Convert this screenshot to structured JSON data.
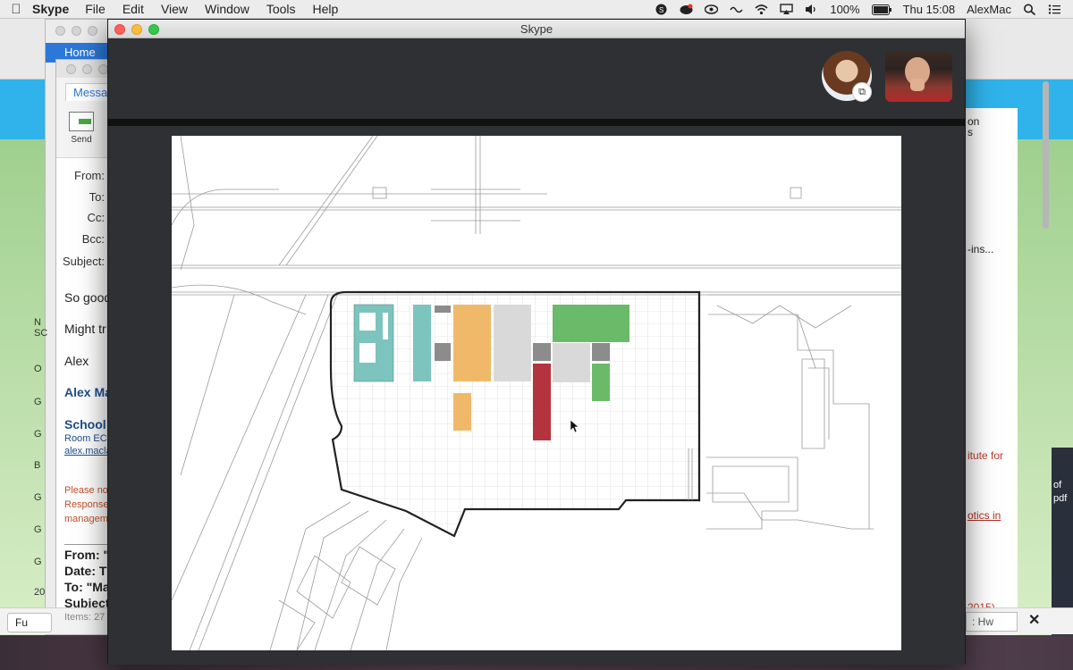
{
  "menubar": {
    "apple": "",
    "app_name": "Skype",
    "items": [
      "File",
      "Edit",
      "View",
      "Window",
      "Tools",
      "Help"
    ],
    "battery": "100%",
    "clock": "Thu 15:08",
    "user": "AlexMac",
    "icons": [
      "skype-icon",
      "creative-cloud-icon",
      "eye-icon",
      "wave-icon",
      "wifi-icon",
      "airplay-icon",
      "volume-icon",
      "battery-icon",
      "search-icon",
      "list-icon"
    ]
  },
  "mail": {
    "home_tab": "Home",
    "message_tab": "Messa",
    "send_label": "Send",
    "fields": {
      "from": "From:",
      "to": "To:",
      "cc": "Cc:",
      "bcc": "Bcc:",
      "subject": "Subject:"
    },
    "body": {
      "line1": "So good",
      "line2": "Might tr",
      "line3": "Alex",
      "sig_name": "Alex Ma",
      "sig_school": "School",
      "sig_room": "Room EC",
      "sig_email": "alex.macla",
      "notice1": "Please no",
      "notice2": "Response",
      "notice3": "managem",
      "quoted_from": "From: \"",
      "quoted_date": "Date: Th",
      "quoted_to": "To: \"Ma",
      "quoted_subject": "Subject"
    },
    "list_letters": [
      "N",
      "SC",
      "O",
      "G",
      "G",
      "B",
      "G",
      "G",
      "G",
      "20"
    ],
    "items_count": "Items: 27"
  },
  "browser": {
    "right_texts": [
      "on",
      "s",
      "-ins...",
      "itute for",
      "otics in",
      "2015)"
    ],
    "dark_corner_texts": [
      "of",
      "pdf"
    ],
    "bottom_file": "Fu",
    "bottom_hw": ": Hw",
    "close_label": "✕"
  },
  "skype": {
    "title": "Skype",
    "badge_icon": "⧉"
  },
  "floorplan": {
    "colors": {
      "teal": "#7cc4bd",
      "orange": "#f0b969",
      "light_gray": "#d9d9d9",
      "dark_gray": "#8c8c8c",
      "green": "#6bba6a",
      "red": "#b3333f"
    }
  }
}
